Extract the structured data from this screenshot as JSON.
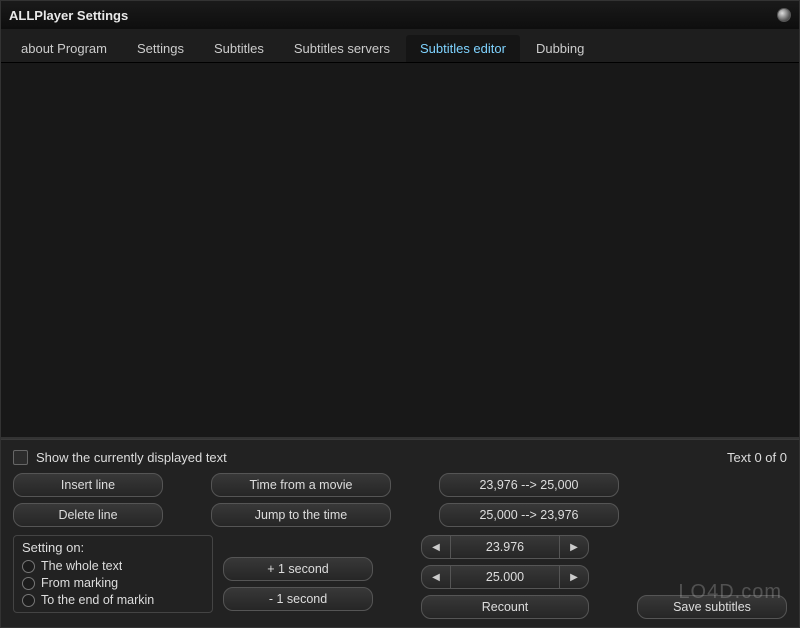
{
  "window": {
    "title": "ALLPlayer Settings"
  },
  "tabs": [
    {
      "label": "about Program",
      "active": false
    },
    {
      "label": "Settings",
      "active": false
    },
    {
      "label": "Subtitles",
      "active": false
    },
    {
      "label": "Subtitles servers",
      "active": false
    },
    {
      "label": "Subtitles editor",
      "active": true
    },
    {
      "label": "Dubbing",
      "active": false
    }
  ],
  "panel": {
    "show_text_label": "Show the currently displayed text",
    "counter": "Text 0 of 0",
    "insert_line": "Insert line",
    "delete_line": "Delete line",
    "time_from_movie": "Time from a movie",
    "jump_to_time": "Jump to the time",
    "fps_up": "23,976  -->  25,000",
    "fps_down": "25,000  -->  23,976",
    "setting_on": "Setting on:",
    "radio1": "The whole text",
    "radio2": "From marking",
    "radio3": "To the end of markin",
    "plus1": "+ 1 second",
    "minus1": "- 1 second",
    "spin1": "23.976",
    "spin2": "25.000",
    "recount": "Recount",
    "save": "Save subtitles"
  },
  "watermark": "LO4D.com"
}
